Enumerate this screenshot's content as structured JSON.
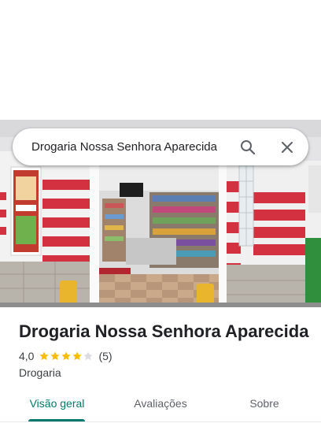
{
  "search": {
    "query": "Drogaria Nossa Senhora Aparecida",
    "search_icon": "search-icon",
    "close_icon": "close-icon"
  },
  "place": {
    "name": "Drogaria Nossa Senhora Aparecida",
    "rating": "4,0",
    "rating_stars": 4,
    "rating_max": 5,
    "reviews": "(5)",
    "category": "Drogaria"
  },
  "tabs": [
    {
      "label": "Visão geral",
      "active": true
    },
    {
      "label": "Avaliações",
      "active": false
    },
    {
      "label": "Sobre",
      "active": false
    }
  ],
  "colors": {
    "accent": "#00796b",
    "star_filled": "#fbbc04",
    "star_empty": "#dadce0",
    "stripe_red": "#d3313f"
  }
}
